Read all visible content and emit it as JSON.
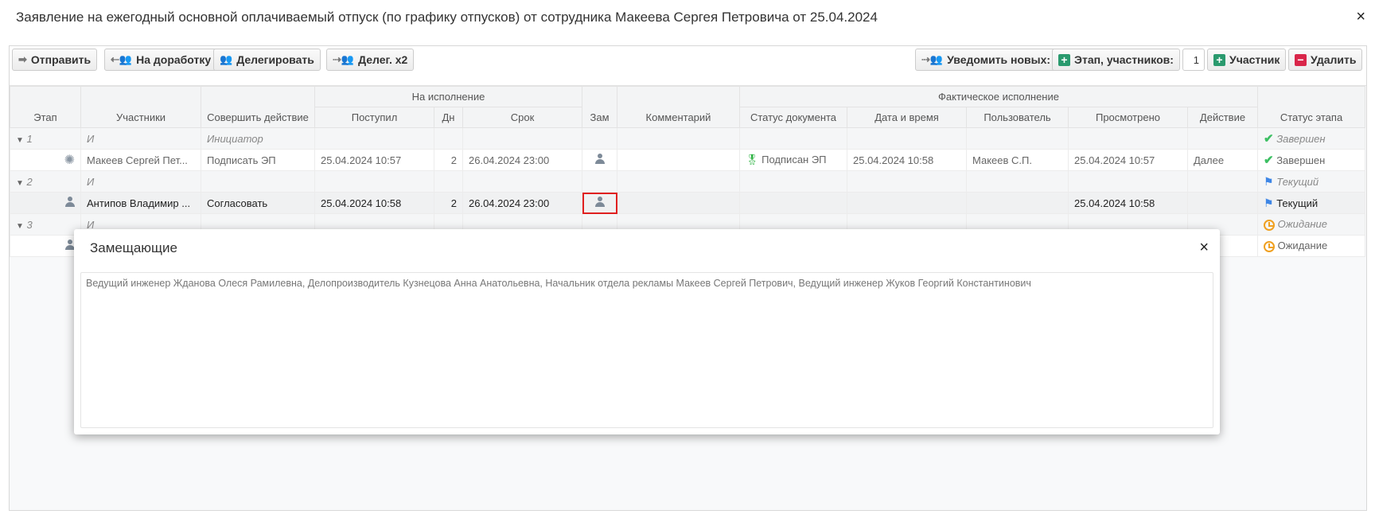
{
  "window": {
    "title": "Заявление на ежегодный основной оплачиваемый отпуск (по графику отпусков) от сотрудника Макеева Сергея Петровича от 25.04.2024",
    "close": "×"
  },
  "toolbar": {
    "send": "Отправить",
    "rework": "На доработку",
    "delegate": "Делегировать",
    "delegate2": "Делег. х2",
    "notify": "Уведомить новых:",
    "stage": "Этап, участников:",
    "stage_count": "1",
    "participant": "Участник",
    "delete": "Удалить"
  },
  "table": {
    "group_headers": {
      "execution": "На исполнение",
      "actual": "Фактическое исполнение"
    },
    "headers": {
      "stage": "Этап",
      "participants": "Участники",
      "action": "Совершить действие",
      "received": "Поступил",
      "days": "Дн",
      "deadline": "Срок",
      "sub": "Зам",
      "comment": "Комментарий",
      "doc_status": "Статус документа",
      "datetime": "Дата и время",
      "user": "Пользователь",
      "viewed": "Просмотрено",
      "act": "Действие",
      "stage_status": "Статус этапа"
    },
    "rows": [
      {
        "stage": "1",
        "participants": "И",
        "action": "Инициатор",
        "stage_status": "Завершен"
      },
      {
        "participants": "Макеев Сергей Пет...",
        "action": "Подписать ЭП",
        "received": "25.04.2024 10:57",
        "days": "2",
        "deadline": "26.04.2024 23:00",
        "doc_status": "Подписан ЭП",
        "datetime": "25.04.2024 10:58",
        "user": "Макеев С.П.",
        "viewed": "25.04.2024 10:57",
        "act": "Далее",
        "stage_status": "Завершен"
      },
      {
        "stage": "2",
        "participants": "И",
        "stage_status": "Текущий"
      },
      {
        "participants": "Антипов Владимир ...",
        "action": "Согласовать",
        "received": "25.04.2024 10:58",
        "days": "2",
        "deadline": "26.04.2024 23:00",
        "viewed": "25.04.2024 10:58",
        "stage_status": "Текущий"
      },
      {
        "stage": "3",
        "participants": "И",
        "stage_status": "Ожидание"
      },
      {
        "stage_status": "Ожидание"
      }
    ]
  },
  "modal": {
    "title": "Замещающие",
    "close": "×",
    "text": "Ведущий инженер Жданова Олеся Рамилевна, Делопроизводитель Кузнецова Анна Анатольевна, Начальник отдела рекламы Макеев Сергей Петрович, Ведущий инженер Жуков Георгий Константинович"
  },
  "colors": {
    "accent_green": "#2a9a6e",
    "accent_red": "#d9264a",
    "highlight": "#e02020",
    "done": "#3cbf63",
    "current": "#3d86e6",
    "waiting": "#f0a020"
  }
}
